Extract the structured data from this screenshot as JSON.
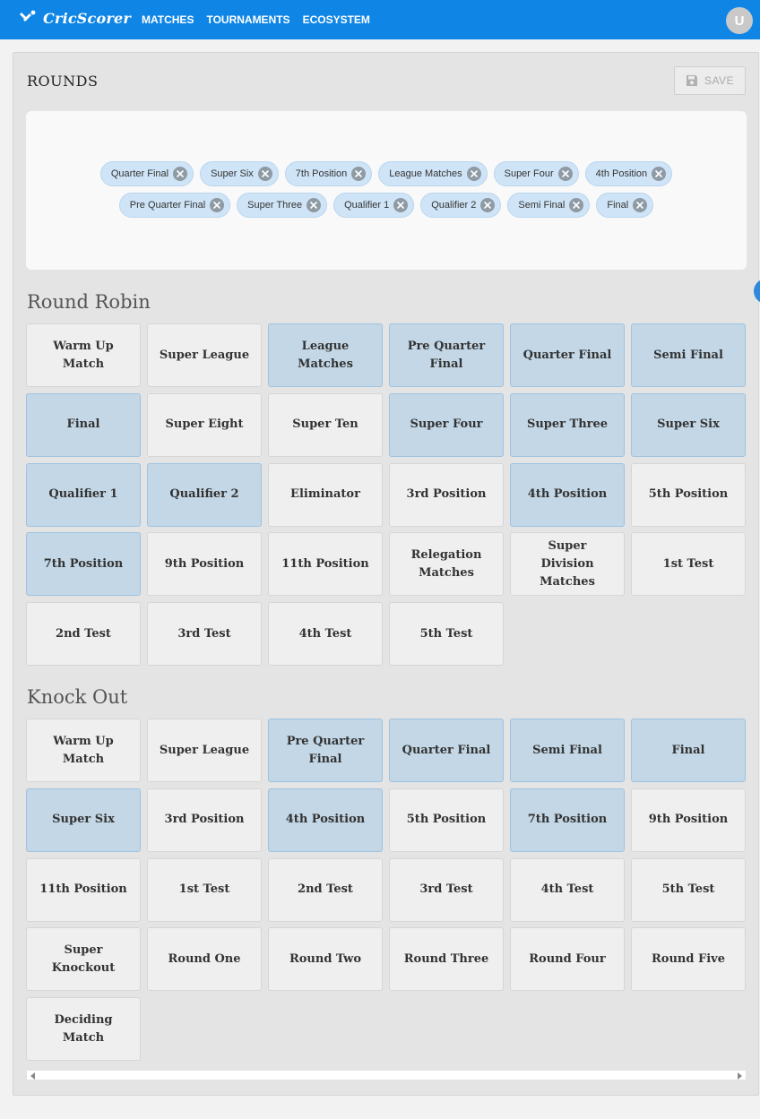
{
  "app": {
    "brand": "CricScorer",
    "avatar_letter": "U",
    "brand_color": "#0f86e6"
  },
  "nav": {
    "items": [
      "MATCHES",
      "TOURNAMENTS",
      "ECOSYSTEM"
    ]
  },
  "rounds": {
    "title": "ROUNDS",
    "save_label": "SAVE",
    "selected_chips": [
      [
        "Quarter Final",
        "Super Six",
        "7th Position",
        "League Matches",
        "Super Four",
        "4th Position"
      ],
      [
        "Pre Quarter Final",
        "Super Three",
        "Qualifier 1",
        "Qualifier 2",
        "Semi Final",
        "Final"
      ]
    ]
  },
  "round_robin": {
    "title": "Round Robin",
    "tiles": [
      {
        "label": "Warm Up Match",
        "selected": false
      },
      {
        "label": "Super League",
        "selected": false
      },
      {
        "label": "League Matches",
        "selected": true
      },
      {
        "label": "Pre Quarter Final",
        "selected": true
      },
      {
        "label": "Quarter Final",
        "selected": true
      },
      {
        "label": "Semi Final",
        "selected": true
      },
      {
        "label": "Final",
        "selected": true
      },
      {
        "label": "Super Eight",
        "selected": false
      },
      {
        "label": "Super Ten",
        "selected": false
      },
      {
        "label": "Super Four",
        "selected": true
      },
      {
        "label": "Super Three",
        "selected": true
      },
      {
        "label": "Super Six",
        "selected": true
      },
      {
        "label": "Qualifier 1",
        "selected": true
      },
      {
        "label": "Qualifier 2",
        "selected": true
      },
      {
        "label": "Eliminator",
        "selected": false
      },
      {
        "label": "3rd Position",
        "selected": false
      },
      {
        "label": "4th Position",
        "selected": true
      },
      {
        "label": "5th Position",
        "selected": false
      },
      {
        "label": "7th Position",
        "selected": true
      },
      {
        "label": "9th Position",
        "selected": false
      },
      {
        "label": "11th Position",
        "selected": false
      },
      {
        "label": "Relegation Matches",
        "selected": false
      },
      {
        "label": "Super Division Matches",
        "selected": false
      },
      {
        "label": "1st Test",
        "selected": false
      },
      {
        "label": "2nd Test",
        "selected": false
      },
      {
        "label": "3rd Test",
        "selected": false
      },
      {
        "label": "4th Test",
        "selected": false
      },
      {
        "label": "5th Test",
        "selected": false
      }
    ]
  },
  "knock_out": {
    "title": "Knock Out",
    "tiles": [
      {
        "label": "Warm Up Match",
        "selected": false
      },
      {
        "label": "Super League",
        "selected": false
      },
      {
        "label": "Pre Quarter Final",
        "selected": true
      },
      {
        "label": "Quarter Final",
        "selected": true
      },
      {
        "label": "Semi Final",
        "selected": true
      },
      {
        "label": "Final",
        "selected": true
      },
      {
        "label": "Super Six",
        "selected": true
      },
      {
        "label": "3rd Position",
        "selected": false
      },
      {
        "label": "4th Position",
        "selected": true
      },
      {
        "label": "5th Position",
        "selected": false
      },
      {
        "label": "7th Position",
        "selected": true
      },
      {
        "label": "9th Position",
        "selected": false
      },
      {
        "label": "11th Position",
        "selected": false
      },
      {
        "label": "1st Test",
        "selected": false
      },
      {
        "label": "2nd Test",
        "selected": false
      },
      {
        "label": "3rd Test",
        "selected": false
      },
      {
        "label": "4th Test",
        "selected": false
      },
      {
        "label": "5th Test",
        "selected": false
      },
      {
        "label": "Super Knockout",
        "selected": false
      },
      {
        "label": "Round One",
        "selected": false
      },
      {
        "label": "Round Two",
        "selected": false
      },
      {
        "label": "Round Three",
        "selected": false
      },
      {
        "label": "Round Four",
        "selected": false
      },
      {
        "label": "Round Five",
        "selected": false
      },
      {
        "label": "Deciding Match",
        "selected": false
      }
    ]
  }
}
